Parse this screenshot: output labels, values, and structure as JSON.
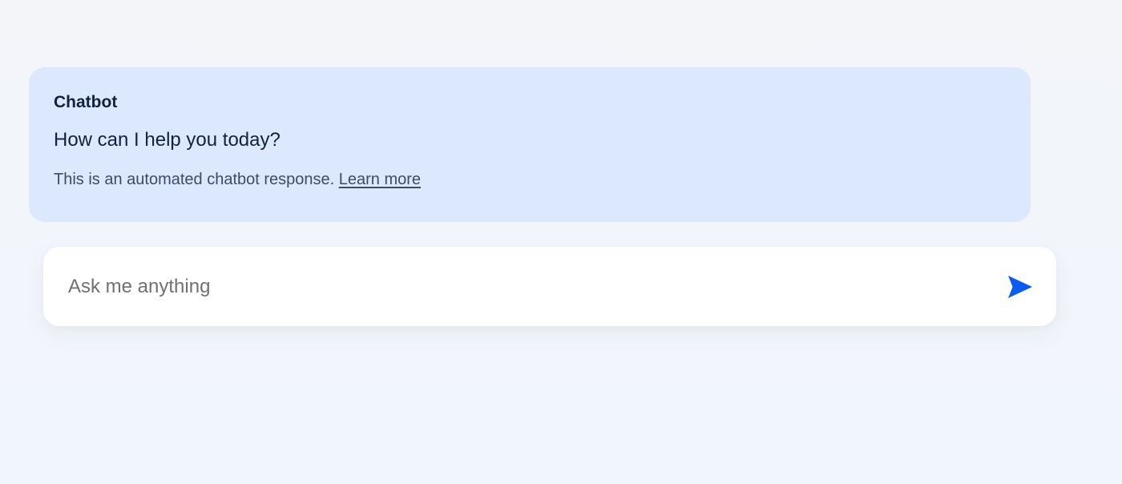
{
  "chat": {
    "sender_name": "Chatbot",
    "message": "How can I help you today?",
    "disclaimer_text": "This is an automated chatbot response. ",
    "learn_more_label": "Learn more"
  },
  "composer": {
    "placeholder": "Ask me anything",
    "value": "",
    "send_icon": "send-icon"
  },
  "colors": {
    "page_background": "#f3f5f9",
    "bot_card_background": "#dbe8fd",
    "accent": "#0b5bf0",
    "text_primary": "#14203f",
    "text_secondary": "#3e4a69"
  }
}
